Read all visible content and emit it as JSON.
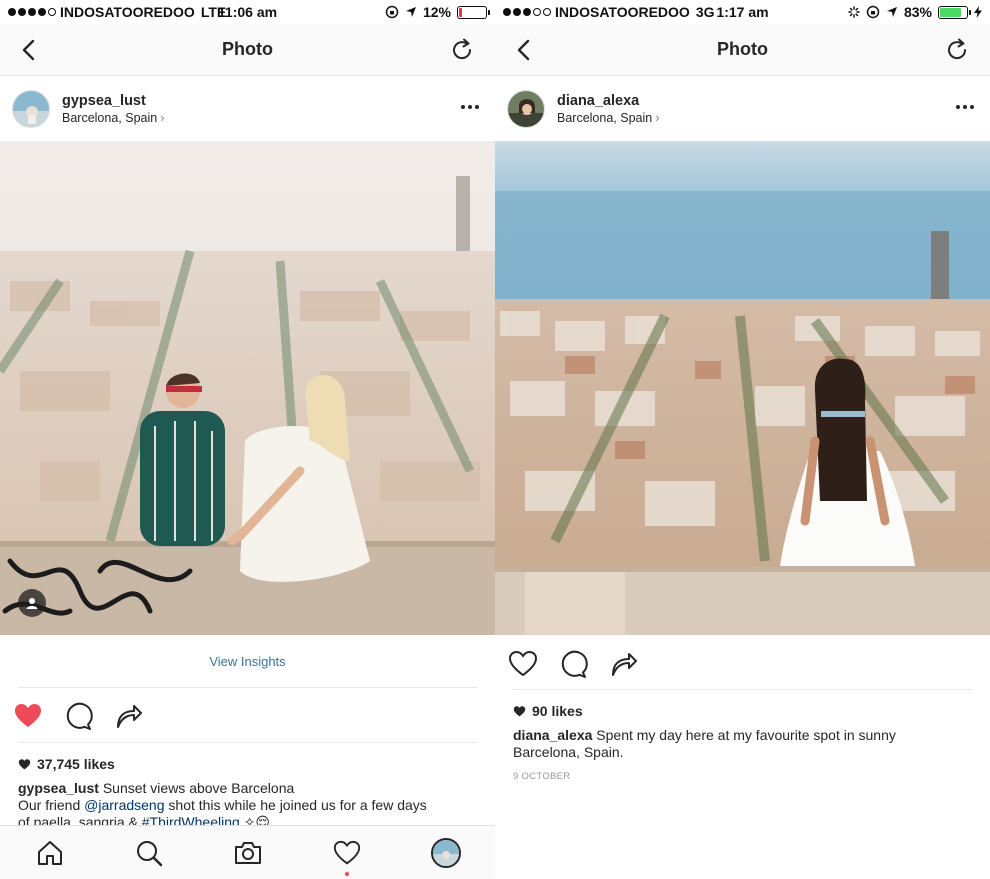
{
  "left": {
    "status": {
      "carrier": "INDOSATOOREDOO",
      "network": "LTE",
      "time": "11:06 am",
      "battery": "12%",
      "battery_level": 0.12,
      "battery_color": "#e53935"
    },
    "nav": {
      "title": "Photo"
    },
    "post": {
      "username": "gypsea_lust",
      "location": "Barcelona, Spain",
      "view_insights": "View Insights",
      "liked": true,
      "likes": "37,745 likes",
      "caption_user": "gypsea_lust",
      "caption_text": "Sunset views above Barcelona",
      "caption_line2_a": "Our friend ",
      "caption_mention": "@jarradseng",
      "caption_line2_b": " shot this while he joined us for a few days",
      "caption_line3_a": "of paella, sangria & ",
      "caption_hashtag": "#ThirdWheeling",
      "caption_line3_b": " ✧😌"
    }
  },
  "right": {
    "status": {
      "carrier": "INDOSATOOREDOO",
      "network": "3G",
      "time": "1:17 am",
      "battery": "83%",
      "battery_level": 0.83,
      "battery_color": "#4cd964"
    },
    "nav": {
      "title": "Photo"
    },
    "post": {
      "username": "diana_alexa",
      "location": "Barcelona, Spain",
      "liked": false,
      "likes": "90 likes",
      "caption_user": "diana_alexa",
      "caption_text": "Spent my day here at my favourite spot in sunny",
      "caption_line2": "Barcelona, Spain.",
      "date": "9 OCTOBER"
    }
  },
  "icons": {
    "back": "chevron-left-icon",
    "refresh": "refresh-icon",
    "more": "more-horizontal-icon",
    "like": "heart-icon",
    "comment": "comment-icon",
    "share": "share-icon",
    "home": "home-icon",
    "search": "search-icon",
    "camera": "camera-icon",
    "activity": "heart-icon",
    "profile": "profile-avatar"
  },
  "colors": {
    "like_red": "#ed4956",
    "link_blue": "#3f729b",
    "mention_blue": "#003569"
  }
}
